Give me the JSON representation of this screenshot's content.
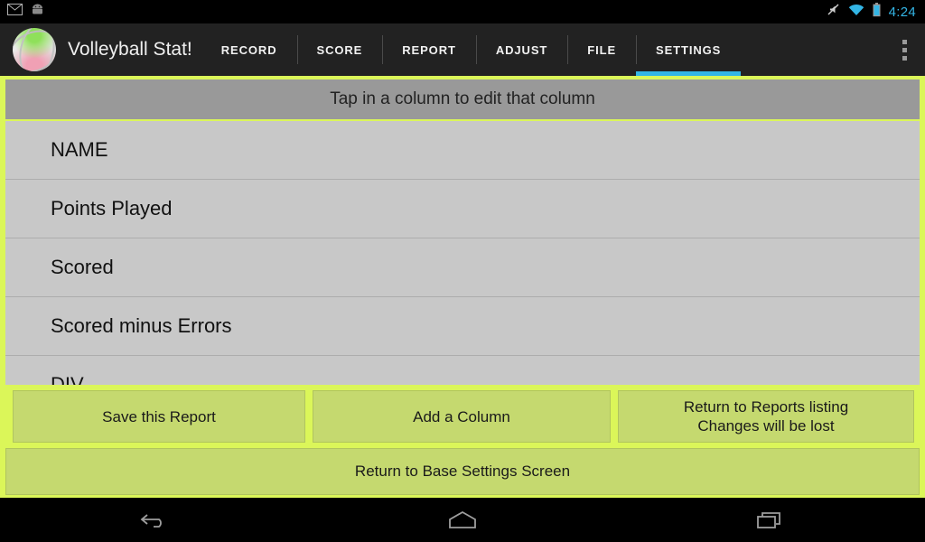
{
  "status_bar": {
    "icons_left": [
      "email-icon",
      "android-icon"
    ],
    "icons_right": [
      "silent-mode-icon",
      "wifi-icon",
      "battery-icon"
    ],
    "time": "4:24",
    "time_color": "#33b5e5"
  },
  "action_bar": {
    "logo": "volleyball-icon",
    "title": "Volleyball Stat!",
    "overflow": "overflow-menu-icon",
    "accent_color": "#33b5e5",
    "tabs": [
      {
        "label": "RECORD",
        "active": false
      },
      {
        "label": "SCORE",
        "active": false
      },
      {
        "label": "REPORT",
        "active": false
      },
      {
        "label": "ADJUST",
        "active": false
      },
      {
        "label": "FILE",
        "active": false
      },
      {
        "label": "SETTINGS",
        "active": true
      }
    ]
  },
  "content": {
    "hint": "Tap in a column to edit that column",
    "border_color": "#dbf659",
    "list_bg": "#c8c8c8",
    "columns": [
      {
        "name": "NAME"
      },
      {
        "name": "Points Played"
      },
      {
        "name": "Scored"
      },
      {
        "name": "Scored minus Errors"
      },
      {
        "name": "DIV"
      }
    ],
    "buttons": {
      "save": "Save this Report",
      "add_column": "Add a Column",
      "return_reports_line1": "Return to Reports listing",
      "return_reports_line2": "Changes will be lost",
      "return_base": "Return to Base Settings Screen",
      "fill_color": "#c5d96f"
    }
  },
  "nav_bar": {
    "back": "back-icon",
    "home": "home-icon",
    "recents": "recents-icon"
  }
}
